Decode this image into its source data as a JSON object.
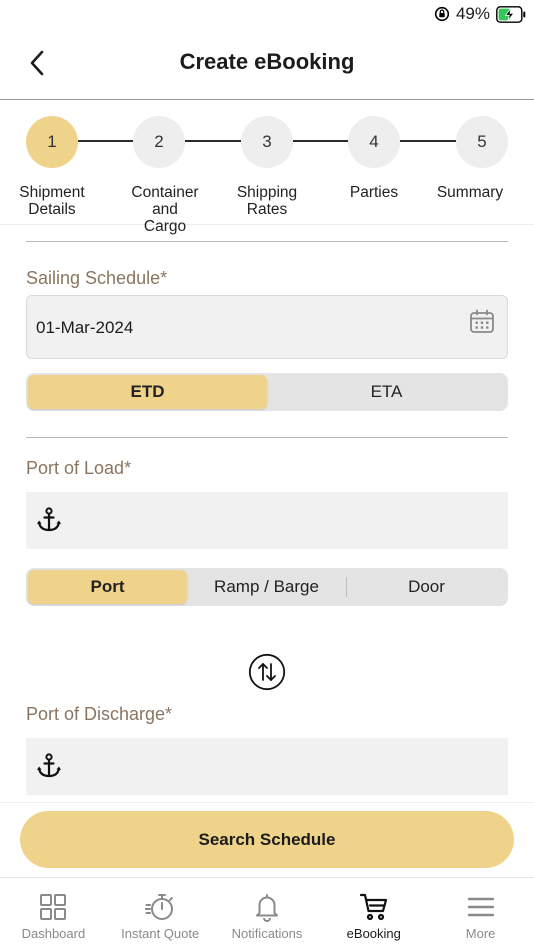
{
  "status_bar": {
    "battery": "49%"
  },
  "header": {
    "title": "Create eBooking"
  },
  "stepper": {
    "steps": [
      {
        "number": "1",
        "label": "Shipment Details"
      },
      {
        "number": "2",
        "label": "Container and Cargo"
      },
      {
        "number": "3",
        "label": "Shipping Rates"
      },
      {
        "number": "4",
        "label": "Parties"
      },
      {
        "number": "5",
        "label": "Summary"
      }
    ],
    "active_step": 1
  },
  "sailing_schedule": {
    "label": "Sailing Schedule*",
    "value": "01-Mar-2024",
    "toggle": {
      "options": [
        "ETD",
        "ETA"
      ],
      "selected": "ETD"
    }
  },
  "port_of_load": {
    "label": "Port of Load*",
    "value": "",
    "type_toggle": {
      "options": [
        "Port",
        "Ramp / Barge",
        "Door"
      ],
      "selected": "Port"
    }
  },
  "port_of_discharge": {
    "label": "Port of Discharge*",
    "value": ""
  },
  "actions": {
    "search_label": "Search Schedule"
  },
  "tab_bar": {
    "items": [
      {
        "label": "Dashboard",
        "icon": "grid-icon"
      },
      {
        "label": "Instant Quote",
        "icon": "stopwatch-icon"
      },
      {
        "label": "Notifications",
        "icon": "bell-icon"
      },
      {
        "label": "eBooking",
        "icon": "cart-icon"
      },
      {
        "label": "More",
        "icon": "menu-icon"
      }
    ],
    "active": "eBooking"
  },
  "colors": {
    "accent": "#f0d38a",
    "label": "#8b7560",
    "field_bg": "#f1f1f1"
  }
}
